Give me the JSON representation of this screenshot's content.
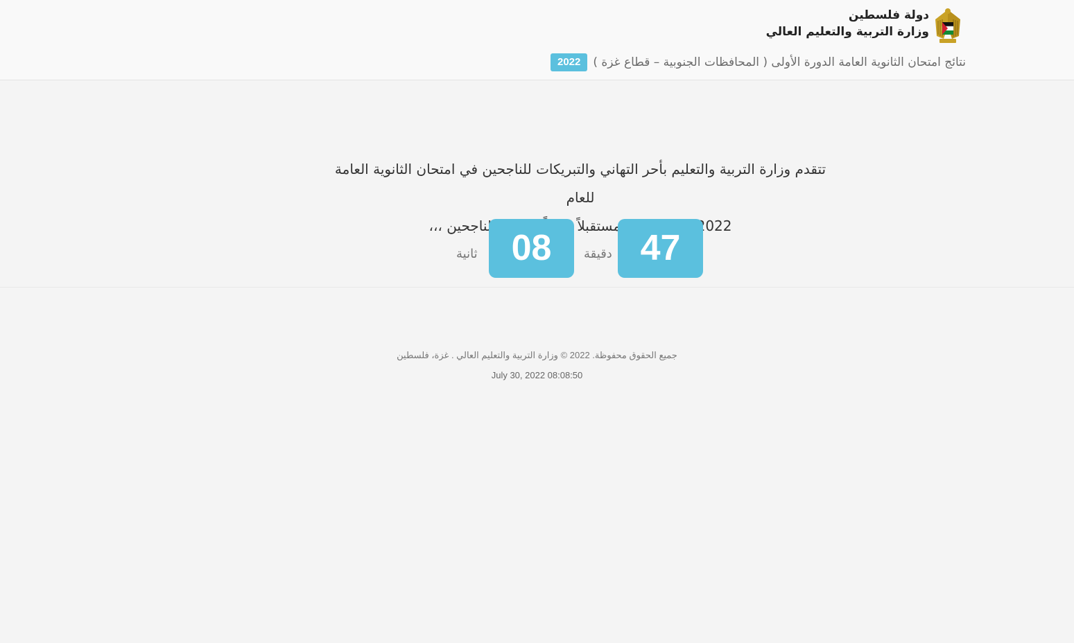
{
  "header": {
    "state_name": "دولة فلسطين",
    "ministry_name": "وزارة التربية والتعليم العالي",
    "subtitle": "نتائج امتحان الثانوية العامة الدورة الأولى ( المحافظات الجنوبية – قطاع غزة )",
    "year_badge": "2022",
    "emblem_icon": "palestine-eagle-emblem-icon"
  },
  "main": {
    "message_line1": "تتقدم وزارة التربية والتعليم بأحر التهاني والتبريكات للناجحين في امتحان الثانوية العامة للعام",
    "message_line2": "2022. وتتمنى لهم مستقبلاً زاهراً. مبارك للناجحين ،،،",
    "countdown": {
      "minutes_value": "47",
      "minutes_label": "دقيقة",
      "seconds_value": "08",
      "seconds_label": "ثانية"
    }
  },
  "footer": {
    "copyright": "جميع الحقوق محفوظة. 2022 © وزارة التربية والتعليم العالي . غزة، فلسطين",
    "datetime": "July 30, 2022 08:08:50"
  },
  "colors": {
    "accent": "#5bc0de",
    "background": "#f4f4f4",
    "header_background": "#f9f9f9"
  }
}
